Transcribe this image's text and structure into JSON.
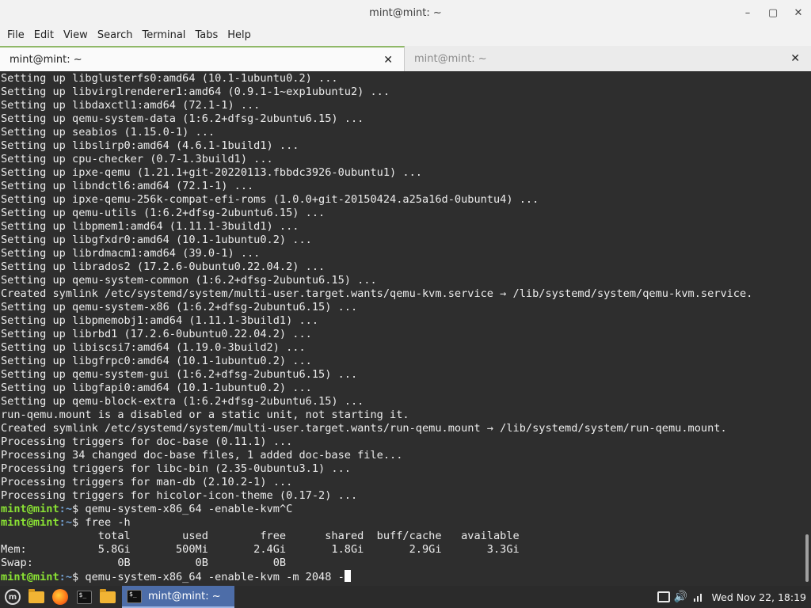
{
  "window": {
    "title": "mint@mint: ~",
    "controls": {
      "minimize": "–",
      "maximize": "▢",
      "close": "✕"
    }
  },
  "menu": [
    "File",
    "Edit",
    "View",
    "Search",
    "Terminal",
    "Tabs",
    "Help"
  ],
  "tabs": [
    {
      "label": "mint@mint: ~",
      "active": true,
      "close": "✕"
    },
    {
      "label": "mint@mint: ~",
      "active": false,
      "close": "✕"
    }
  ],
  "terminal": {
    "output": [
      "Setting up libglusterfs0:amd64 (10.1-1ubuntu0.2) ...",
      "Setting up libvirglrenderer1:amd64 (0.9.1-1~exp1ubuntu2) ...",
      "Setting up libdaxctl1:amd64 (72.1-1) ...",
      "Setting up qemu-system-data (1:6.2+dfsg-2ubuntu6.15) ...",
      "Setting up seabios (1.15.0-1) ...",
      "Setting up libslirp0:amd64 (4.6.1-1build1) ...",
      "Setting up cpu-checker (0.7-1.3build1) ...",
      "Setting up ipxe-qemu (1.21.1+git-20220113.fbbdc3926-0ubuntu1) ...",
      "Setting up libndctl6:amd64 (72.1-1) ...",
      "Setting up ipxe-qemu-256k-compat-efi-roms (1.0.0+git-20150424.a25a16d-0ubuntu4) ...",
      "Setting up qemu-utils (1:6.2+dfsg-2ubuntu6.15) ...",
      "Setting up libpmem1:amd64 (1.11.1-3build1) ...",
      "Setting up libgfxdr0:amd64 (10.1-1ubuntu0.2) ...",
      "Setting up librdmacm1:amd64 (39.0-1) ...",
      "Setting up librados2 (17.2.6-0ubuntu0.22.04.2) ...",
      "Setting up qemu-system-common (1:6.2+dfsg-2ubuntu6.15) ...",
      "Created symlink /etc/systemd/system/multi-user.target.wants/qemu-kvm.service → /lib/systemd/system/qemu-kvm.service.",
      "Setting up qemu-system-x86 (1:6.2+dfsg-2ubuntu6.15) ...",
      "Setting up libpmemobj1:amd64 (1.11.1-3build1) ...",
      "Setting up librbd1 (17.2.6-0ubuntu0.22.04.2) ...",
      "Setting up libiscsi7:amd64 (1.19.0-3build2) ...",
      "Setting up libgfrpc0:amd64 (10.1-1ubuntu0.2) ...",
      "Setting up qemu-system-gui (1:6.2+dfsg-2ubuntu6.15) ...",
      "Setting up libgfapi0:amd64 (10.1-1ubuntu0.2) ...",
      "Setting up qemu-block-extra (1:6.2+dfsg-2ubuntu6.15) ...",
      "run-qemu.mount is a disabled or a static unit, not starting it.",
      "Created symlink /etc/systemd/system/multi-user.target.wants/run-qemu.mount → /lib/systemd/system/run-qemu.mount.",
      "Processing triggers for doc-base (0.11.1) ...",
      "Processing 34 changed doc-base files, 1 added doc-base file...",
      "Processing triggers for libc-bin (2.35-0ubuntu3.1) ...",
      "Processing triggers for man-db (2.10.2-1) ...",
      "Processing triggers for hicolor-icon-theme (0.17-2) ..."
    ],
    "prompt_user": "mint@mint",
    "prompt_path": ":~",
    "prompt_symbol": "$ ",
    "cmd1": "qemu-system-x86_64 -enable-kvm^C",
    "cmd2": "free -h",
    "free_output": [
      "               total        used        free      shared  buff/cache   available",
      "Mem:           5.8Gi       500Mi       2.4Gi       1.8Gi       2.9Gi       3.3Gi",
      "Swap:             0B          0B          0B"
    ],
    "current_input": "qemu-system-x86_64 -enable-kvm -m 2048 -"
  },
  "taskbar": {
    "menu_logo": "m",
    "terminal_icon_text": "$_",
    "task_window_label": "mint@mint: ~",
    "clock": "Wed Nov 22, 18:19",
    "volume_glyph": "🔊"
  }
}
